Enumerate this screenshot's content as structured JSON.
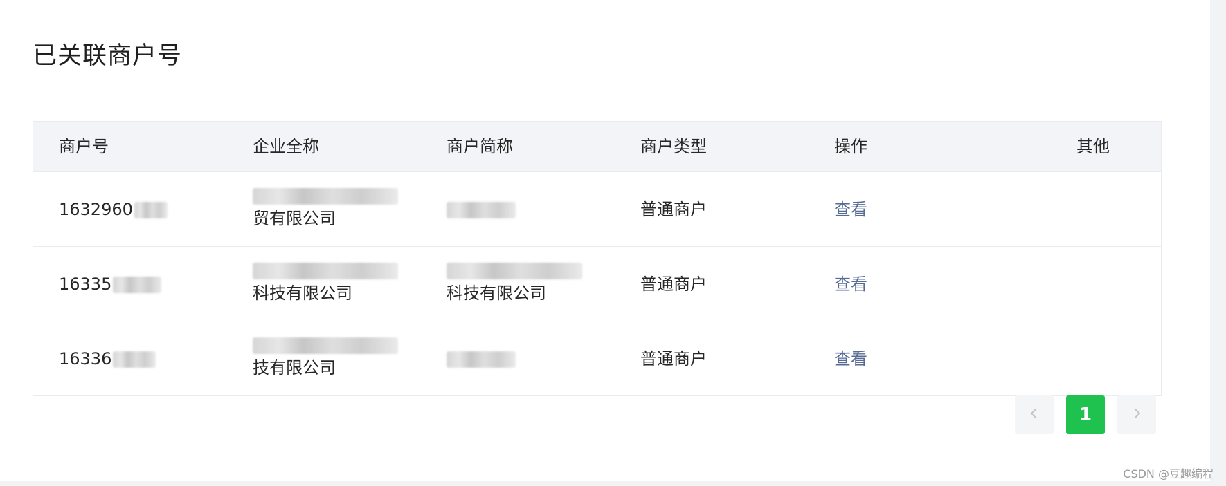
{
  "page": {
    "title": "已关联商户号"
  },
  "table": {
    "headers": [
      "商户号",
      "企业全称",
      "商户简称",
      "商户类型",
      "操作",
      "其他"
    ],
    "rows": [
      {
        "merchant_id_prefix": "1632960",
        "company_name_visible": "贸有限公司",
        "short_name_visible": "",
        "merchant_type": "普通商户",
        "action": "查看"
      },
      {
        "merchant_id_prefix": "16335",
        "company_name_visible": "科技有限公司",
        "short_name_visible": "科技有限公司",
        "merchant_type": "普通商户",
        "action": "查看"
      },
      {
        "merchant_id_prefix": "16336",
        "company_name_visible": "技有限公司",
        "short_name_visible": "",
        "merchant_type": "普通商户",
        "action": "查看"
      }
    ]
  },
  "pagination": {
    "prev_icon": "chevron-left-icon",
    "current_page": "1",
    "next_icon": "chevron-right-icon"
  },
  "watermark": "CSDN @豆趣编程",
  "colors": {
    "link": "#576b95",
    "active_page": "#1fc14f",
    "header_bg": "#f3f4f7"
  }
}
